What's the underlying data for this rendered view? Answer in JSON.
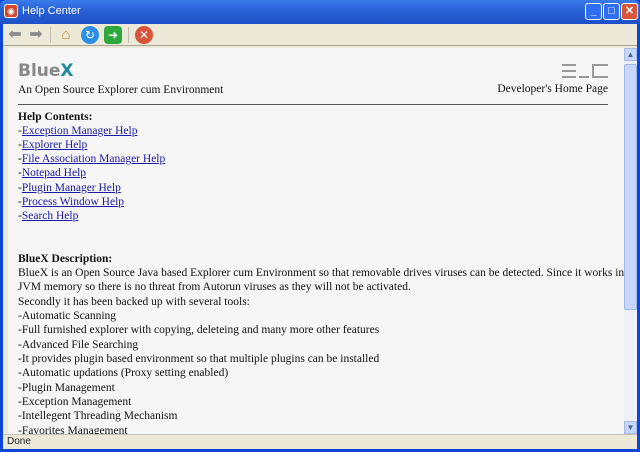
{
  "window": {
    "title": "Help Center",
    "status": "Done"
  },
  "toolbar": {
    "buttons": [
      "back",
      "forward",
      "home",
      "refresh",
      "go",
      "stop"
    ]
  },
  "header": {
    "logo_main": "Blue",
    "logo_accent": "X",
    "tagline": "An Open Source Explorer cum Environment",
    "dev_link": "Developer's Home Page"
  },
  "help": {
    "heading": "Help Contents:",
    "items": [
      "Exception Manager Help",
      "Explorer Help",
      "File Association Manager Help",
      "Notepad Help",
      "Plugin Manager Help",
      "Process Window Help",
      "Search Help"
    ]
  },
  "description": {
    "heading": "BlueX Description:",
    "lines": [
      "BlueX is an Open Source Java based Explorer cum Environment so that removable drives viruses can be detected. Since it works in the",
      "JVM memory so there is no threat from Autorun viruses as they will not be activated.",
      "Secondly it has been backed up with several tools:",
      "-Automatic Scanning",
      "-Full furnished explorer with copying, deleteing and many more other features",
      "-Advanced File Searching",
      "-It provides plugin based environment so that multiple plugins can be installed",
      "-Automatic updations (Proxy setting enabled)",
      "-Plugin Management",
      "-Exception Management",
      "-Intellegent Threading Mechanism",
      "-Favorites Management"
    ]
  }
}
